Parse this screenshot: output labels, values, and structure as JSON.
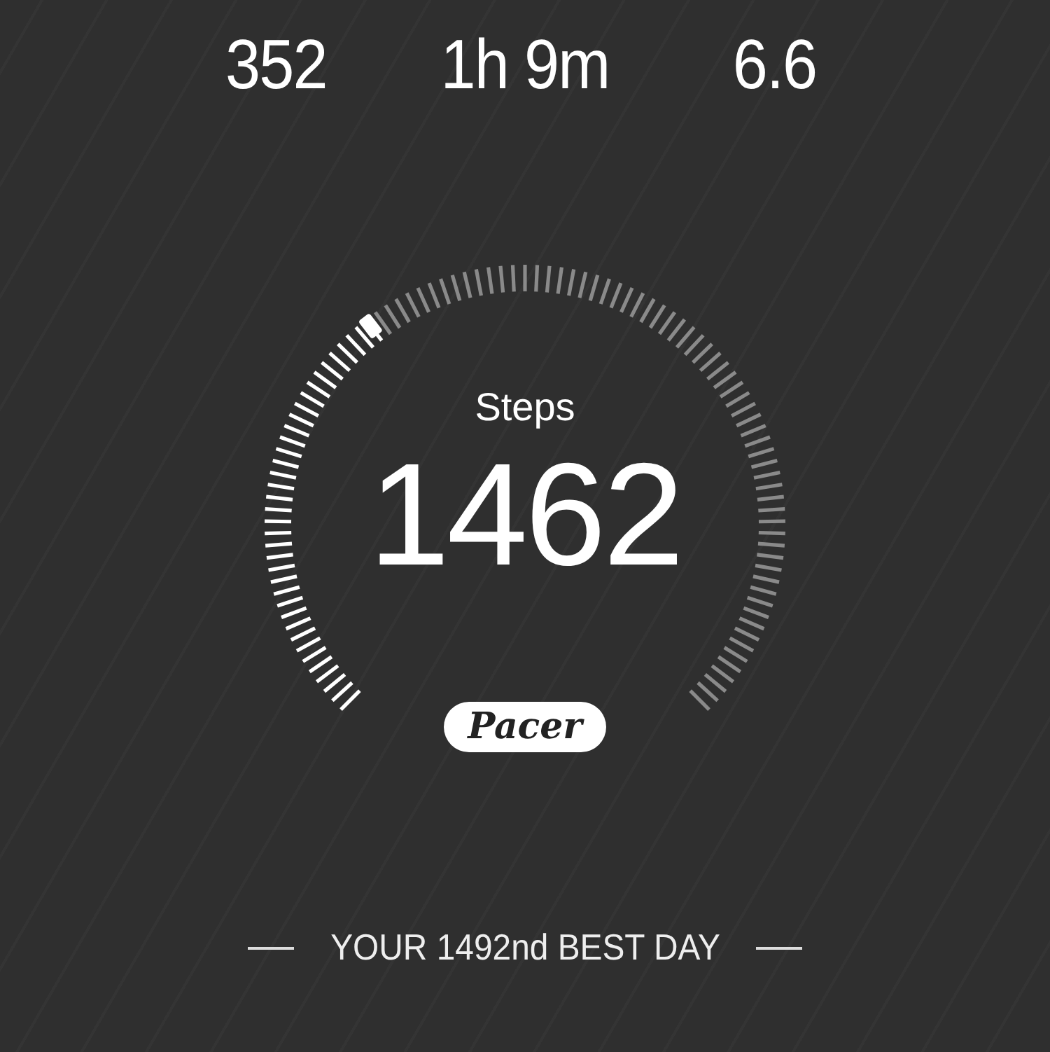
{
  "stats": [
    {
      "value": "352"
    },
    {
      "value": "1h 9m"
    },
    {
      "value": "6.6"
    }
  ],
  "gauge": {
    "label": "Steps",
    "value": "1462"
  },
  "logo": {
    "text": "Pacer"
  },
  "footer": {
    "text": "YOUR 1492nd BEST DAY"
  }
}
